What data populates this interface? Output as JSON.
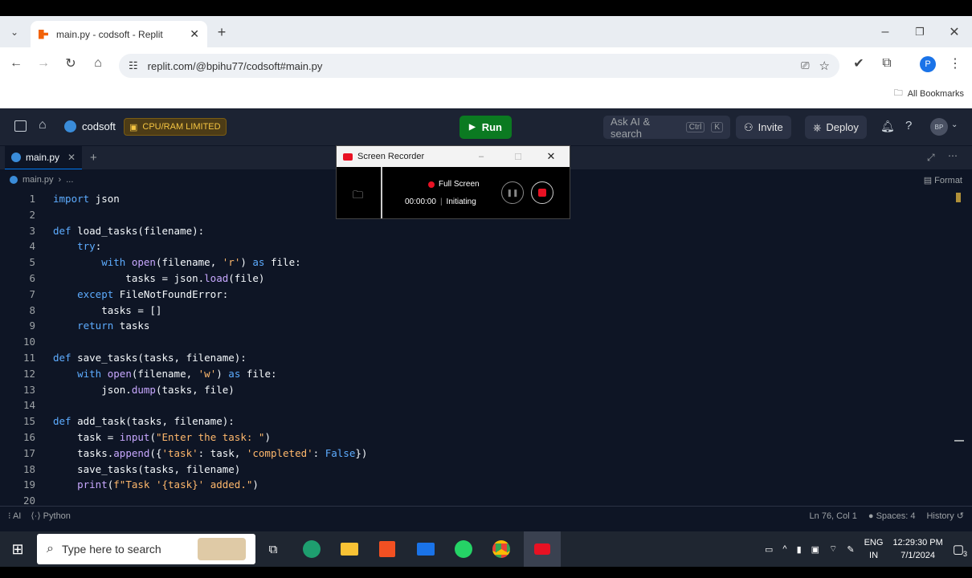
{
  "browser": {
    "tab_title": "main.py - codsoft - Replit",
    "new_tab_label": "+",
    "url": "replit.com/@bpihu77/codsoft#main.py",
    "bookmarks_label": "All Bookmarks",
    "profile_initial": "P"
  },
  "replit": {
    "repl_name": "codsoft",
    "cpu_badge": "CPU/RAM LIMITED",
    "run_label": "Run",
    "ask_ai": "Ask AI & search",
    "shortcut_ctrl": "Ctrl",
    "shortcut_k": "K",
    "invite_label": "Invite",
    "deploy_label": "Deploy",
    "avatar_initials": "BP",
    "file_tab": "main.py",
    "breadcrumb_file": "main.py",
    "breadcrumb_more": "...",
    "format_label": "Format",
    "status_ai": "AI",
    "status_lang": "Python",
    "status_pos": "Ln 76, Col 1",
    "status_spaces": "Spaces: 4",
    "status_history": "History"
  },
  "code_lines": [
    {
      "n": "1",
      "t": "import json"
    },
    {
      "n": "2",
      "t": ""
    },
    {
      "n": "3",
      "t": "def load_tasks(filename):"
    },
    {
      "n": "4",
      "t": "    try:"
    },
    {
      "n": "5",
      "t": "        with open(filename, 'r') as file:"
    },
    {
      "n": "6",
      "t": "            tasks = json.load(file)"
    },
    {
      "n": "7",
      "t": "    except FileNotFoundError:"
    },
    {
      "n": "8",
      "t": "        tasks = []"
    },
    {
      "n": "9",
      "t": "    return tasks"
    },
    {
      "n": "10",
      "t": ""
    },
    {
      "n": "11",
      "t": "def save_tasks(tasks, filename):"
    },
    {
      "n": "12",
      "t": "    with open(filename, 'w') as file:"
    },
    {
      "n": "13",
      "t": "        json.dump(tasks, file)"
    },
    {
      "n": "14",
      "t": ""
    },
    {
      "n": "15",
      "t": "def add_task(tasks, filename):"
    },
    {
      "n": "16",
      "t": "    task = input(\"Enter the task: \")"
    },
    {
      "n": "17",
      "t": "    tasks.append({'task': task, 'completed': False})"
    },
    {
      "n": "18",
      "t": "    save_tasks(tasks, filename)"
    },
    {
      "n": "19",
      "t": "    print(f\"Task '{task}' added.\")"
    },
    {
      "n": "20",
      "t": ""
    }
  ],
  "recorder": {
    "title": "Screen Recorder",
    "mode": "Full Screen",
    "time": "00:00:00",
    "state": "Initiating"
  },
  "taskbar": {
    "search_placeholder": "Type here to search",
    "lang_top": "ENG",
    "lang_bottom": "IN",
    "time": "12:29:30 PM",
    "date": "7/1/2024",
    "notification_count": "3"
  },
  "colors": {
    "run_green": "#0b7a21",
    "editor_bg": "#0e1525",
    "topbar_bg": "#1c2333",
    "recorder_red": "#e81123"
  }
}
